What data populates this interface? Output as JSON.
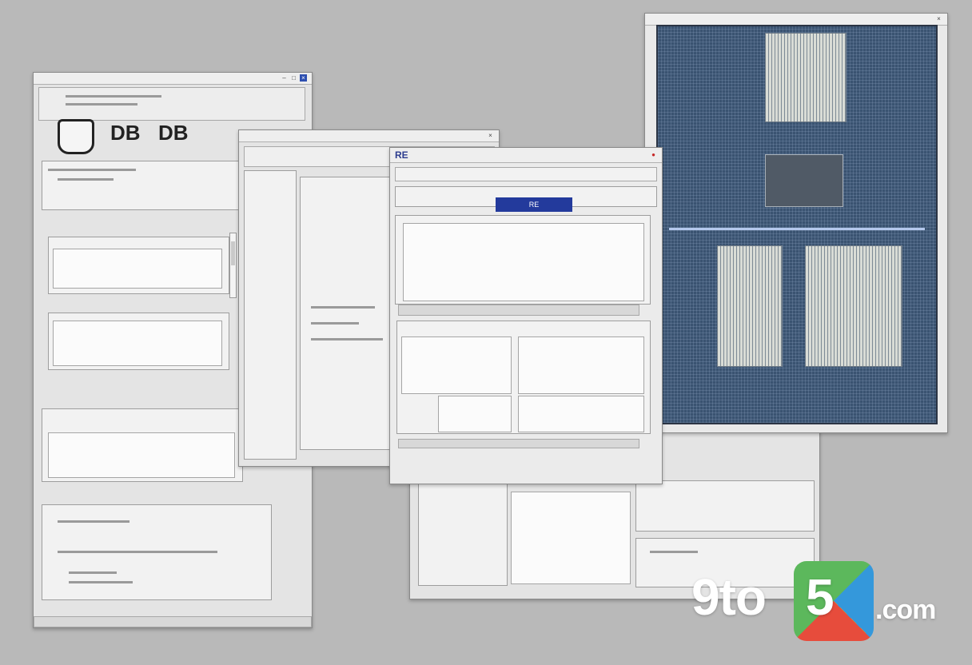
{
  "watermark": {
    "prefix": "9to",
    "digit": "5",
    "suffix": ".com"
  },
  "colors": {
    "desktop_bg": "#b9b9b9",
    "accent_blue": "#233a9c",
    "board_blue": "#3a5371",
    "logo_green": "#5cb85c",
    "logo_red": "#e74c3c",
    "logo_orange": "#f39c12",
    "logo_blue": "#3498db"
  },
  "left_window": {
    "logo_a": "DB",
    "logo_b": "DB"
  },
  "front_window": {
    "title": "RE",
    "selected_tab": "RE"
  },
  "icons": [
    "window-icon",
    "close-icon",
    "minimize-icon",
    "maximize-icon",
    "scrollbar",
    "circuit-board-image"
  ]
}
